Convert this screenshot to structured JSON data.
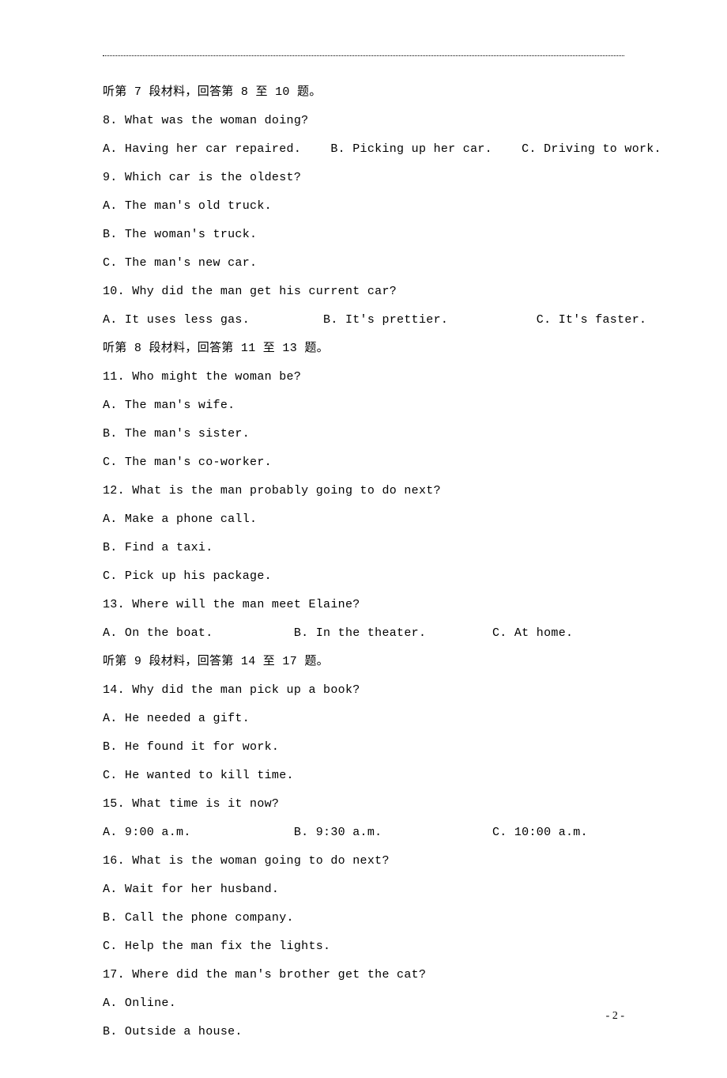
{
  "sections": [
    {
      "intro": "听第 7 段材料，回答第 8 至 10 题。",
      "questions": [
        {
          "stem": "8. What was the woman doing?",
          "options_inline": "A. Having her car repaired.    B. Picking up her car.    C. Driving to work."
        },
        {
          "stem": "9. Which car is the oldest?",
          "options": [
            "A. The man's old truck.",
            "B. The woman's truck.",
            "C. The man's new car."
          ]
        },
        {
          "stem": "10. Why did the man get his current car?",
          "options_inline": "A. It uses less gas.          B. It's prettier.            C. It's faster."
        }
      ]
    },
    {
      "intro": "听第 8 段材料，回答第 11 至 13 题。",
      "questions": [
        {
          "stem": "11. Who might the woman be?",
          "options": [
            "A. The man's wife.",
            "B. The man's sister.",
            "C. The man's co-worker."
          ]
        },
        {
          "stem": "12. What is the man probably going to do next?",
          "options": [
            "A. Make a phone call.",
            "B. Find a taxi.",
            "C. Pick up his package."
          ]
        },
        {
          "stem": "13. Where will the man meet Elaine?",
          "options_inline": "A. On the boat.           B. In the theater.         C. At home."
        }
      ]
    },
    {
      "intro": "听第 9 段材料，回答第 14 至 17 题。",
      "questions": [
        {
          "stem": "14. Why did the man pick up a book?",
          "options": [
            "A. He needed a gift.",
            "B. He found it for work.",
            "C. He wanted to kill time."
          ]
        },
        {
          "stem": "15. What time is it now?",
          "options_inline": "A. 9:00 a.m.              B. 9:30 a.m.               C. 10:00 a.m."
        },
        {
          "stem": "16. What is the woman going to do next?",
          "options": [
            "A. Wait for her husband.",
            "B. Call the phone company.",
            "C. Help the man fix the lights."
          ]
        },
        {
          "stem": "17. Where did the man's brother get the cat?",
          "options": [
            "A. Online.",
            "B. Outside a house."
          ]
        }
      ]
    }
  ],
  "page_number": "- 2 -"
}
